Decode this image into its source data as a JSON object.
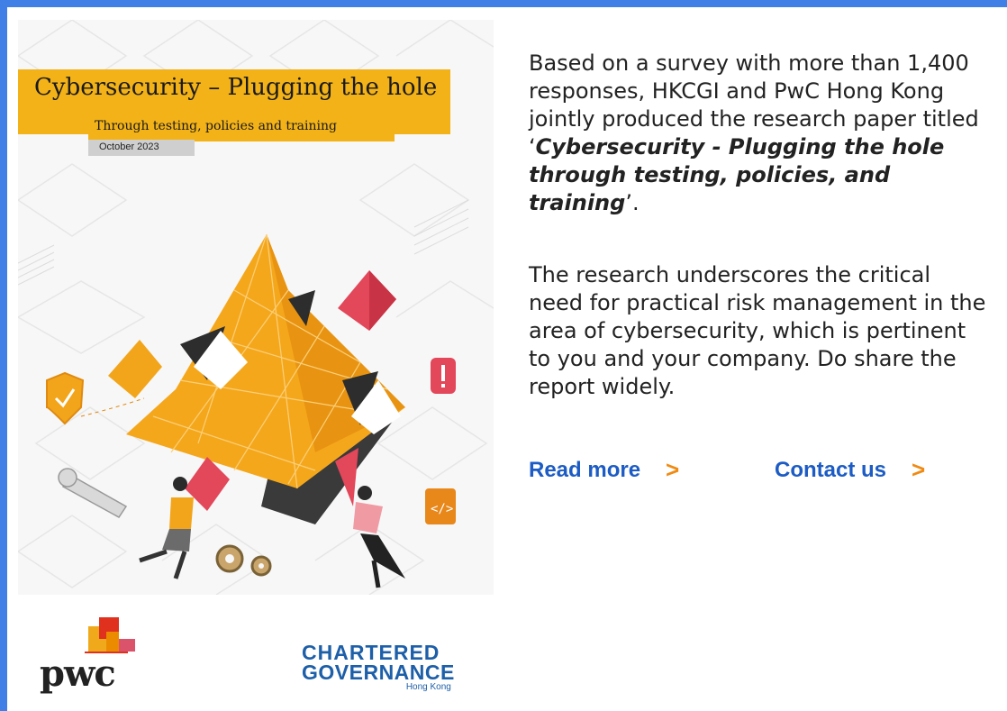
{
  "cover": {
    "title": "Cybersecurity – Plugging the hole",
    "subtitle": "Through testing, policies and training",
    "date": "October 2023"
  },
  "body": {
    "p1_before": "Based on a survey with more than 1,400 responses, HKCGI and PwC Hong Kong jointly produced the research paper titled ‘",
    "p1_title": "Cybersecurity - Plugging the hole through testing, policies, and training",
    "p1_after": "’.",
    "p2": "The research underscores the critical need for practical risk management in the area of cybersecurity, which is pertinent to you and your company. Do share the report widely."
  },
  "links": {
    "read_more": "Read more",
    "contact_us": "Contact us",
    "chevron": ">"
  },
  "logos": {
    "pwc": "pwc",
    "cg_line1": "CHARTERED",
    "cg_line2": "GOVERNANCE",
    "cg_line3": "Hong Kong"
  },
  "colors": {
    "frame": "#3f7fe6",
    "accent_yellow": "#f2b218",
    "link_blue": "#1c5cc4",
    "chevron_orange": "#f08a12"
  },
  "icons": [
    "shield-check-icon",
    "warning-icon",
    "wrench-icon",
    "gear-icon",
    "code-icon"
  ]
}
